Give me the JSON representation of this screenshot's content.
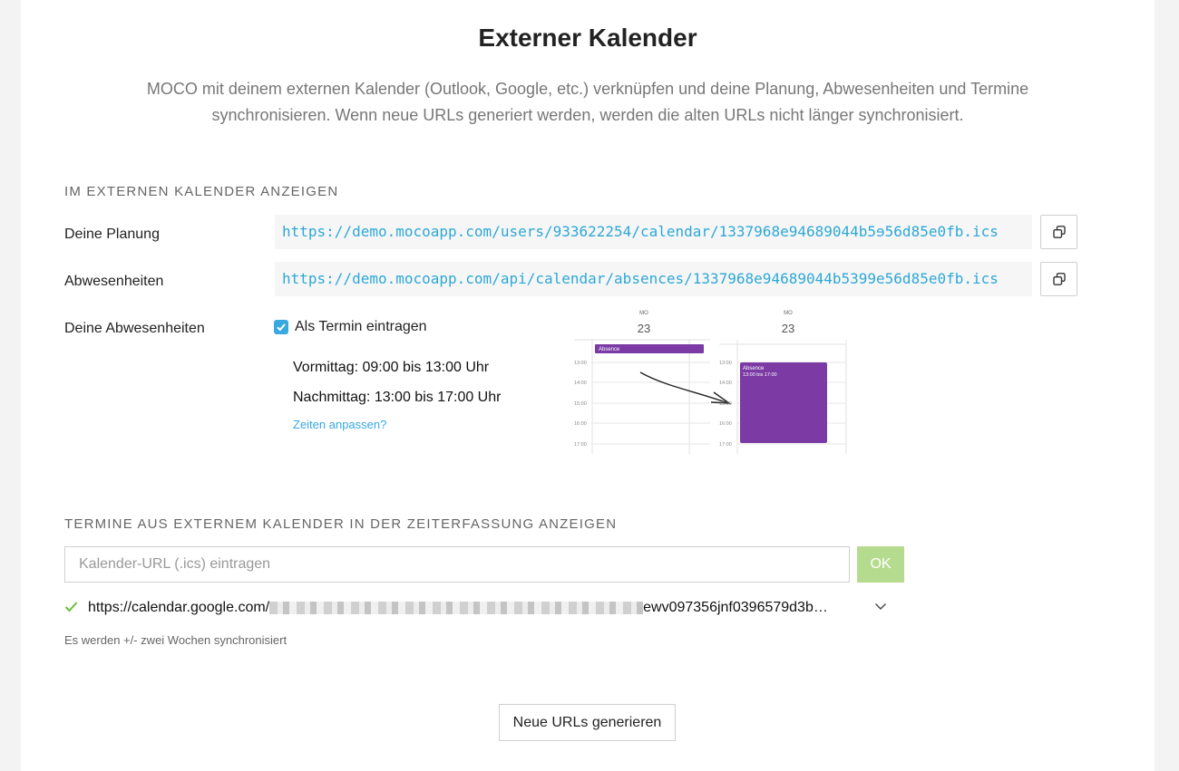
{
  "header": {
    "title": "Externer Kalender",
    "intro": "MOCO mit deinem externen Kalender (Outlook, Google, etc.) verknüpfen und deine Planung, Abwesenheiten und Termine synchronisieren. Wenn neue URLs generiert werden, werden die alten URLs nicht länger synchronisiert."
  },
  "export_section": {
    "title": "IM EXTERNEN KALENDER ANZEIGEN",
    "planning": {
      "label": "Deine Planung",
      "url": "https://demo.mocoapp.com/users/933622254/calendar/1337968e94689044b5ɘ56d85e0fb.ics",
      "copy_icon": "copy-icon"
    },
    "absences": {
      "label": "Abwesenheiten",
      "url": "https://demo.mocoapp.com/api/calendar/absences/1337968e94689044b5399e56d85e0fb.ics",
      "copy_icon": "copy-icon"
    },
    "own_absences": {
      "label": "Deine Abwesenheiten",
      "checkbox_label": "Als Termin eintragen",
      "checked": true,
      "morning": "Vormittag: 09:00 bis 13:00 Uhr",
      "afternoon": "Nachmittag: 13:00 bis 17:00 Uhr",
      "adjust_link": "Zeiten anpassen?"
    },
    "illustration": {
      "day_name": "MO",
      "day_number": "23",
      "hours": [
        "13:00",
        "14:00",
        "15:00",
        "16:00",
        "17:00"
      ],
      "event_title": "Absence",
      "event_time": "13:00 bis 17:00",
      "event_color": "#7b3aa4"
    }
  },
  "import_section": {
    "title": "TERMINE AUS EXTERNEM KALENDER IN DER ZEITERFASSUNG ANZEIGEN",
    "input_placeholder": "Kalender-URL (.ics) eintragen",
    "ok_label": "OK",
    "feed": {
      "url_start": "https://calendar.google.com/",
      "url_end": "ewv097356jnf0396579d3b…",
      "status_icon": "check-icon",
      "expand_icon": "chevron-down-icon"
    },
    "sync_note": "Es werden +/- zwei Wochen synchronisiert"
  },
  "footer": {
    "generate_label": "Neue URLs generieren"
  },
  "colors": {
    "accent": "#37a8e0",
    "ok_button": "#b5dc8e",
    "check_green": "#6bbf3a"
  }
}
